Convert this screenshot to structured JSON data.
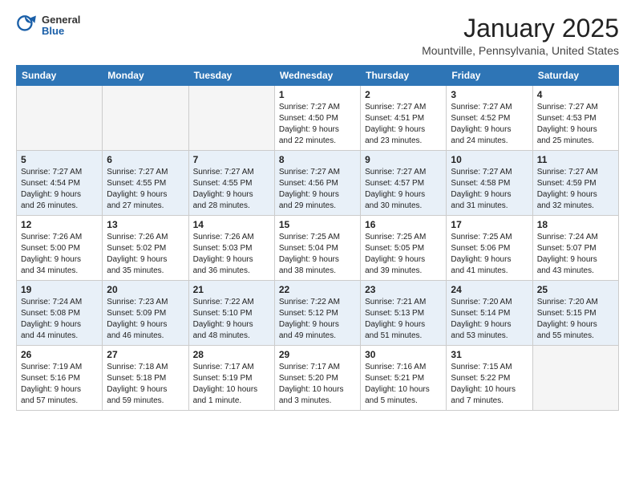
{
  "logo": {
    "general": "General",
    "blue": "Blue"
  },
  "header": {
    "title": "January 2025",
    "subtitle": "Mountville, Pennsylvania, United States"
  },
  "weekdays": [
    "Sunday",
    "Monday",
    "Tuesday",
    "Wednesday",
    "Thursday",
    "Friday",
    "Saturday"
  ],
  "weeks": [
    [
      {
        "day": "",
        "info": ""
      },
      {
        "day": "",
        "info": ""
      },
      {
        "day": "",
        "info": ""
      },
      {
        "day": "1",
        "info": "Sunrise: 7:27 AM\nSunset: 4:50 PM\nDaylight: 9 hours\nand 22 minutes."
      },
      {
        "day": "2",
        "info": "Sunrise: 7:27 AM\nSunset: 4:51 PM\nDaylight: 9 hours\nand 23 minutes."
      },
      {
        "day": "3",
        "info": "Sunrise: 7:27 AM\nSunset: 4:52 PM\nDaylight: 9 hours\nand 24 minutes."
      },
      {
        "day": "4",
        "info": "Sunrise: 7:27 AM\nSunset: 4:53 PM\nDaylight: 9 hours\nand 25 minutes."
      }
    ],
    [
      {
        "day": "5",
        "info": "Sunrise: 7:27 AM\nSunset: 4:54 PM\nDaylight: 9 hours\nand 26 minutes."
      },
      {
        "day": "6",
        "info": "Sunrise: 7:27 AM\nSunset: 4:55 PM\nDaylight: 9 hours\nand 27 minutes."
      },
      {
        "day": "7",
        "info": "Sunrise: 7:27 AM\nSunset: 4:55 PM\nDaylight: 9 hours\nand 28 minutes."
      },
      {
        "day": "8",
        "info": "Sunrise: 7:27 AM\nSunset: 4:56 PM\nDaylight: 9 hours\nand 29 minutes."
      },
      {
        "day": "9",
        "info": "Sunrise: 7:27 AM\nSunset: 4:57 PM\nDaylight: 9 hours\nand 30 minutes."
      },
      {
        "day": "10",
        "info": "Sunrise: 7:27 AM\nSunset: 4:58 PM\nDaylight: 9 hours\nand 31 minutes."
      },
      {
        "day": "11",
        "info": "Sunrise: 7:27 AM\nSunset: 4:59 PM\nDaylight: 9 hours\nand 32 minutes."
      }
    ],
    [
      {
        "day": "12",
        "info": "Sunrise: 7:26 AM\nSunset: 5:00 PM\nDaylight: 9 hours\nand 34 minutes."
      },
      {
        "day": "13",
        "info": "Sunrise: 7:26 AM\nSunset: 5:02 PM\nDaylight: 9 hours\nand 35 minutes."
      },
      {
        "day": "14",
        "info": "Sunrise: 7:26 AM\nSunset: 5:03 PM\nDaylight: 9 hours\nand 36 minutes."
      },
      {
        "day": "15",
        "info": "Sunrise: 7:25 AM\nSunset: 5:04 PM\nDaylight: 9 hours\nand 38 minutes."
      },
      {
        "day": "16",
        "info": "Sunrise: 7:25 AM\nSunset: 5:05 PM\nDaylight: 9 hours\nand 39 minutes."
      },
      {
        "day": "17",
        "info": "Sunrise: 7:25 AM\nSunset: 5:06 PM\nDaylight: 9 hours\nand 41 minutes."
      },
      {
        "day": "18",
        "info": "Sunrise: 7:24 AM\nSunset: 5:07 PM\nDaylight: 9 hours\nand 43 minutes."
      }
    ],
    [
      {
        "day": "19",
        "info": "Sunrise: 7:24 AM\nSunset: 5:08 PM\nDaylight: 9 hours\nand 44 minutes."
      },
      {
        "day": "20",
        "info": "Sunrise: 7:23 AM\nSunset: 5:09 PM\nDaylight: 9 hours\nand 46 minutes."
      },
      {
        "day": "21",
        "info": "Sunrise: 7:22 AM\nSunset: 5:10 PM\nDaylight: 9 hours\nand 48 minutes."
      },
      {
        "day": "22",
        "info": "Sunrise: 7:22 AM\nSunset: 5:12 PM\nDaylight: 9 hours\nand 49 minutes."
      },
      {
        "day": "23",
        "info": "Sunrise: 7:21 AM\nSunset: 5:13 PM\nDaylight: 9 hours\nand 51 minutes."
      },
      {
        "day": "24",
        "info": "Sunrise: 7:20 AM\nSunset: 5:14 PM\nDaylight: 9 hours\nand 53 minutes."
      },
      {
        "day": "25",
        "info": "Sunrise: 7:20 AM\nSunset: 5:15 PM\nDaylight: 9 hours\nand 55 minutes."
      }
    ],
    [
      {
        "day": "26",
        "info": "Sunrise: 7:19 AM\nSunset: 5:16 PM\nDaylight: 9 hours\nand 57 minutes."
      },
      {
        "day": "27",
        "info": "Sunrise: 7:18 AM\nSunset: 5:18 PM\nDaylight: 9 hours\nand 59 minutes."
      },
      {
        "day": "28",
        "info": "Sunrise: 7:17 AM\nSunset: 5:19 PM\nDaylight: 10 hours\nand 1 minute."
      },
      {
        "day": "29",
        "info": "Sunrise: 7:17 AM\nSunset: 5:20 PM\nDaylight: 10 hours\nand 3 minutes."
      },
      {
        "day": "30",
        "info": "Sunrise: 7:16 AM\nSunset: 5:21 PM\nDaylight: 10 hours\nand 5 minutes."
      },
      {
        "day": "31",
        "info": "Sunrise: 7:15 AM\nSunset: 5:22 PM\nDaylight: 10 hours\nand 7 minutes."
      },
      {
        "day": "",
        "info": ""
      }
    ]
  ]
}
